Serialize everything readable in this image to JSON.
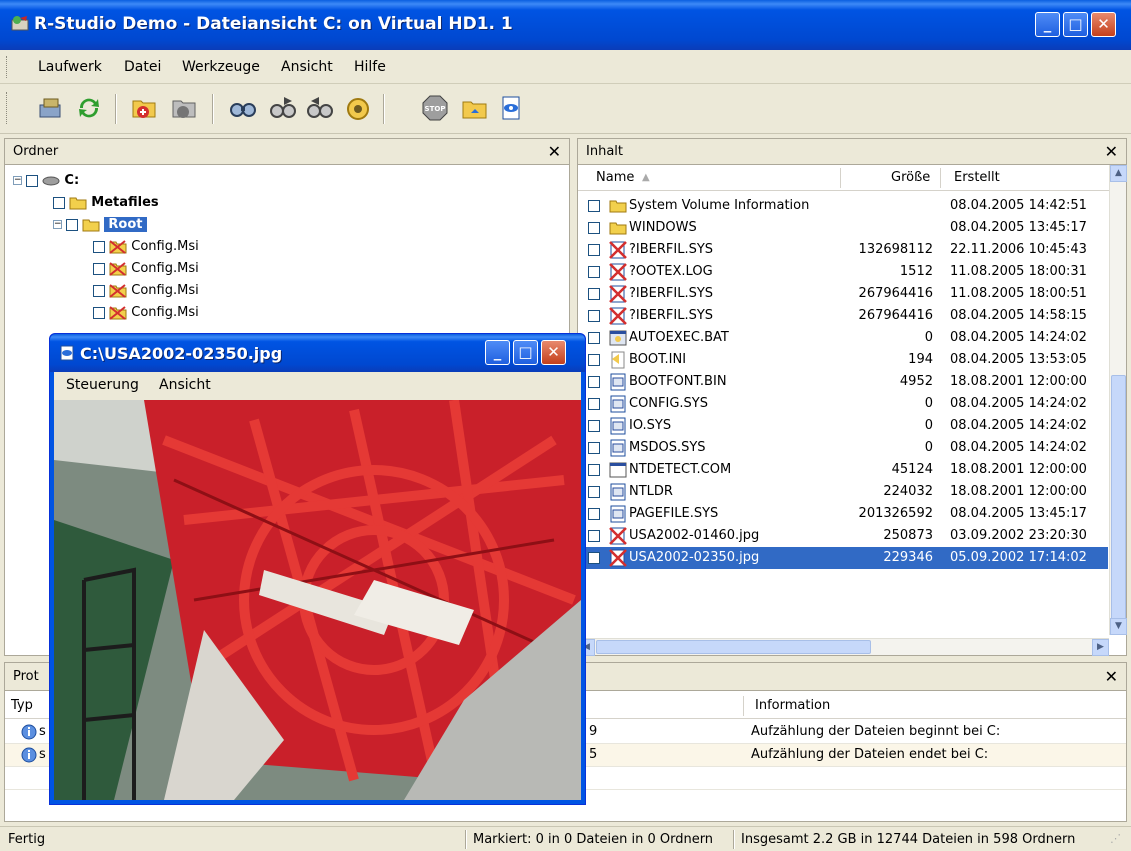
{
  "window": {
    "title": "R-Studio Demo - Dateiansicht C: on Virtual HD1. 1",
    "minimize": "_",
    "maximize": "□",
    "close": "✕"
  },
  "menu": {
    "items": [
      {
        "label": "Laufwerk"
      },
      {
        "label": "Datei"
      },
      {
        "label": "Werkzeuge"
      },
      {
        "label": "Ansicht"
      },
      {
        "label": "Hilfe"
      }
    ]
  },
  "toolbar": {
    "buttons": [
      "drive-icon",
      "refresh-icon",
      "recover-icon",
      "recover-marked-icon",
      "find-icon",
      "find-next-icon",
      "find-previous-icon",
      "mask-icon",
      "stop-icon",
      "open-folder-icon",
      "preview-icon"
    ]
  },
  "folders_panel": {
    "label": "Ordner",
    "close": "✕",
    "tree": [
      {
        "label": "C:"
      },
      {
        "label": "Metafiles"
      },
      {
        "label": "Root"
      },
      {
        "label": "Config.Msi"
      },
      {
        "label": "Config.Msi"
      },
      {
        "label": "Config.Msi"
      },
      {
        "label": "Config.Msi"
      }
    ]
  },
  "content_panel": {
    "label": "Inhalt",
    "close": "✕",
    "columns": {
      "name": "Name",
      "size": "Größe",
      "created": "Erstellt"
    },
    "rows": [
      {
        "name": "System Volume Information",
        "size": "",
        "created": "08.04.2005 14:42:51",
        "icon": "folder"
      },
      {
        "name": "WINDOWS",
        "size": "",
        "created": "08.04.2005 13:45:17",
        "icon": "folder"
      },
      {
        "name": "?IBERFIL.SYS",
        "size": "132698112",
        "created": "22.11.2006 10:45:43",
        "icon": "deleted"
      },
      {
        "name": "?OOTEX.LOG",
        "size": "1512",
        "created": "11.08.2005 18:00:31",
        "icon": "deleted"
      },
      {
        "name": "?IBERFIL.SYS",
        "size": "267964416",
        "created": "11.08.2005 18:00:51",
        "icon": "deleted"
      },
      {
        "name": "?IBERFIL.SYS",
        "size": "267964416",
        "created": "08.04.2005 14:58:15",
        "icon": "deleted"
      },
      {
        "name": "AUTOEXEC.BAT",
        "size": "0",
        "created": "08.04.2005 14:24:02",
        "icon": "bat"
      },
      {
        "name": "BOOT.INI",
        "size": "194",
        "created": "08.04.2005 13:53:05",
        "icon": "ini"
      },
      {
        "name": "BOOTFONT.BIN",
        "size": "4952",
        "created": "18.08.2001 12:00:00",
        "icon": "sys"
      },
      {
        "name": "CONFIG.SYS",
        "size": "0",
        "created": "08.04.2005 14:24:02",
        "icon": "sys"
      },
      {
        "name": "IO.SYS",
        "size": "0",
        "created": "08.04.2005 14:24:02",
        "icon": "sys"
      },
      {
        "name": "MSDOS.SYS",
        "size": "0",
        "created": "08.04.2005 14:24:02",
        "icon": "sys"
      },
      {
        "name": "NTDETECT.COM",
        "size": "45124",
        "created": "18.08.2001 12:00:00",
        "icon": "com"
      },
      {
        "name": "NTLDR",
        "size": "224032",
        "created": "18.08.2001 12:00:00",
        "icon": "sys"
      },
      {
        "name": "PAGEFILE.SYS",
        "size": "201326592",
        "created": "08.04.2005 13:45:17",
        "icon": "sys"
      },
      {
        "name": "USA2002-01460.jpg",
        "size": "250873",
        "created": "03.09.2002 23:20:30",
        "icon": "deleted"
      },
      {
        "name": "USA2002-02350.jpg",
        "size": "229346",
        "created": "05.09.2002 17:14:02",
        "icon": "deleted",
        "selected": true
      }
    ]
  },
  "log_panel": {
    "label": "Prot",
    "close": "✕",
    "col_type": "Typ",
    "col_info": "Information",
    "rows": [
      {
        "type": "s",
        "mid": "9",
        "info": "Aufzählung der Dateien beginnt bei C:"
      },
      {
        "type": "s",
        "mid": "5",
        "info": "Aufzählung der Dateien endet bei C:"
      }
    ]
  },
  "viewer": {
    "title": "C:\\USA2002-02350.jpg",
    "menu": [
      {
        "label": "Steuerung"
      },
      {
        "label": "Ansicht"
      }
    ]
  },
  "status": {
    "left": "Fertig",
    "marked": "Markiert: 0 in 0 Dateien in 0 Ordnern",
    "total": "Insgesamt 2.2 GB in 12744 Dateien in 598 Ordnern"
  }
}
